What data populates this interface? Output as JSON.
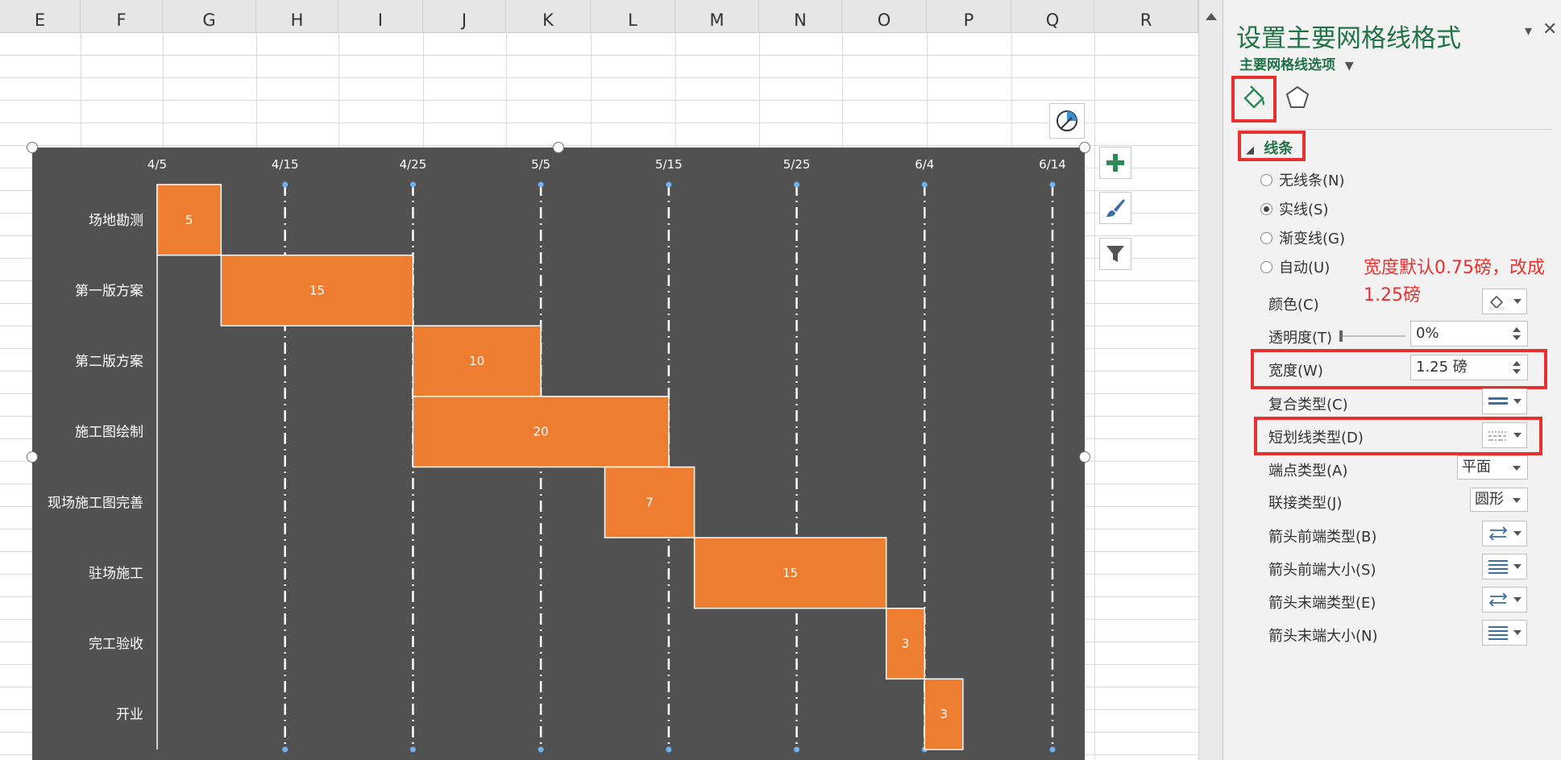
{
  "columns": [
    "E",
    "F",
    "G",
    "H",
    "I",
    "J",
    "K",
    "L",
    "M",
    "N",
    "O",
    "P",
    "Q",
    "R"
  ],
  "chart_data": {
    "type": "bar",
    "orientation": "horizontal-gantt",
    "x_ticks": [
      "4/5",
      "4/15",
      "4/25",
      "5/5",
      "5/15",
      "5/25",
      "6/4",
      "6/14"
    ],
    "xlim": [
      "4/5",
      "6/14"
    ],
    "gridlines": "dash-dot, white",
    "categories": [
      "场地勘测",
      "第一版方案",
      "第二版方案",
      "施工图绘制",
      "现场施工图完善",
      "驻场施工",
      "完工验收",
      "开业"
    ],
    "tasks": [
      {
        "name": "场地勘测",
        "start": "4/5",
        "duration": 5,
        "label": "5"
      },
      {
        "name": "第一版方案",
        "start": "4/10",
        "duration": 15,
        "label": "15"
      },
      {
        "name": "第二版方案",
        "start": "4/25",
        "duration": 10,
        "label": "10"
      },
      {
        "name": "施工图绘制",
        "start": "4/25",
        "duration": 20,
        "label": "20"
      },
      {
        "name": "现场施工图完善",
        "start": "5/10",
        "duration": 7,
        "label": "7"
      },
      {
        "name": "驻场施工",
        "start": "5/17",
        "duration": 15,
        "label": "15"
      },
      {
        "name": "完工验收",
        "start": "6/1",
        "duration": 3,
        "label": "3"
      },
      {
        "name": "开业",
        "start": "6/4",
        "duration": 3,
        "label": "3"
      }
    ],
    "bar_color": "#ed7d31",
    "plot_background": "#515151"
  },
  "chart_buttons": [
    "add-element-icon",
    "chart-style-brush-icon",
    "chart-filter-icon",
    "layout-options-icon"
  ],
  "panel": {
    "title": "设置主要网格线格式",
    "subtitle": "主要网格线选项",
    "section": "线条",
    "radio_none": "无线条(N)",
    "radio_solid": "实线(S)",
    "radio_gradient": "渐变线(G)",
    "radio_auto": "自动(U)",
    "selected_radio": "实线(S)",
    "color_label": "颜色(C)",
    "transparency_label": "透明度(T)",
    "transparency_value": "0%",
    "width_label": "宽度(W)",
    "width_value": "1.25 磅",
    "compound_label": "复合类型(C)",
    "dash_label": "短划线类型(D)",
    "cap_label": "端点类型(A)",
    "cap_value": "平面",
    "join_label": "联接类型(J)",
    "join_value": "圆形",
    "arrow_begin_type": "箭头前端类型(B)",
    "arrow_begin_size": "箭头前端大小(S)",
    "arrow_end_type": "箭头末端类型(E)",
    "arrow_end_size": "箭头末端大小(N)",
    "annotation": "宽度默认0.75磅，改成1.25磅",
    "accent": "#217346",
    "highlight": "#e8312f"
  }
}
